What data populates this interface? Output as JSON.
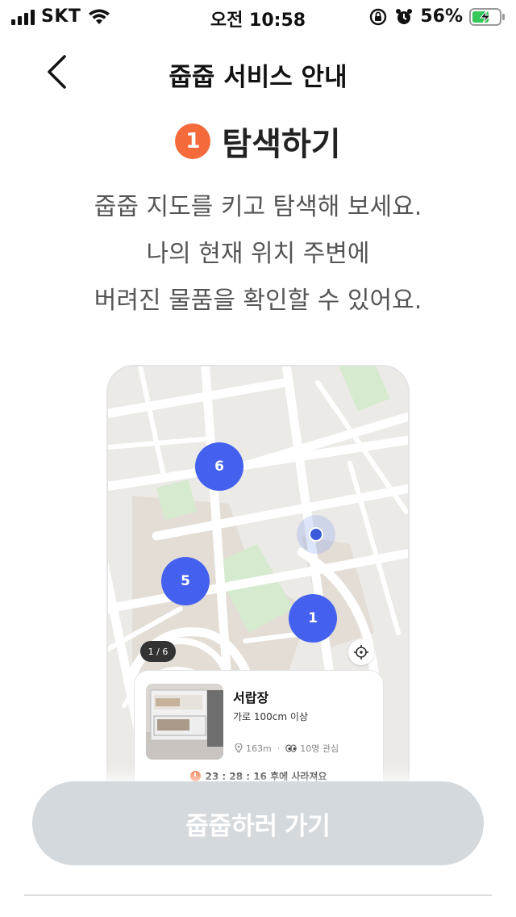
{
  "status_bar": {
    "carrier": "SKT",
    "time": "오전 10:58",
    "battery": "56%"
  },
  "header": {
    "title": "줍줍 서비스 안내"
  },
  "step": {
    "number": "1",
    "title": "탐색하기",
    "description": [
      "줍줍 지도를 키고 탐색해 보세요.",
      "나의 현재 위치 주변에",
      "버려진 물품을 확인할 수 있어요."
    ]
  },
  "map": {
    "clusters": [
      "6",
      "5",
      "1"
    ],
    "page_indicator": "1 / 6"
  },
  "item_card": {
    "name": "서랍장",
    "description": "가로 100cm 이상",
    "distance": "163m",
    "interest": "10명 관심",
    "timer": "23 : 28 : 16 후에 사라져요"
  },
  "cta": {
    "label": "줍줍하러 가기"
  },
  "colors": {
    "accent": "#f46a3b",
    "cluster": "#4361ee",
    "cta_disabled": "#d4d9de"
  }
}
